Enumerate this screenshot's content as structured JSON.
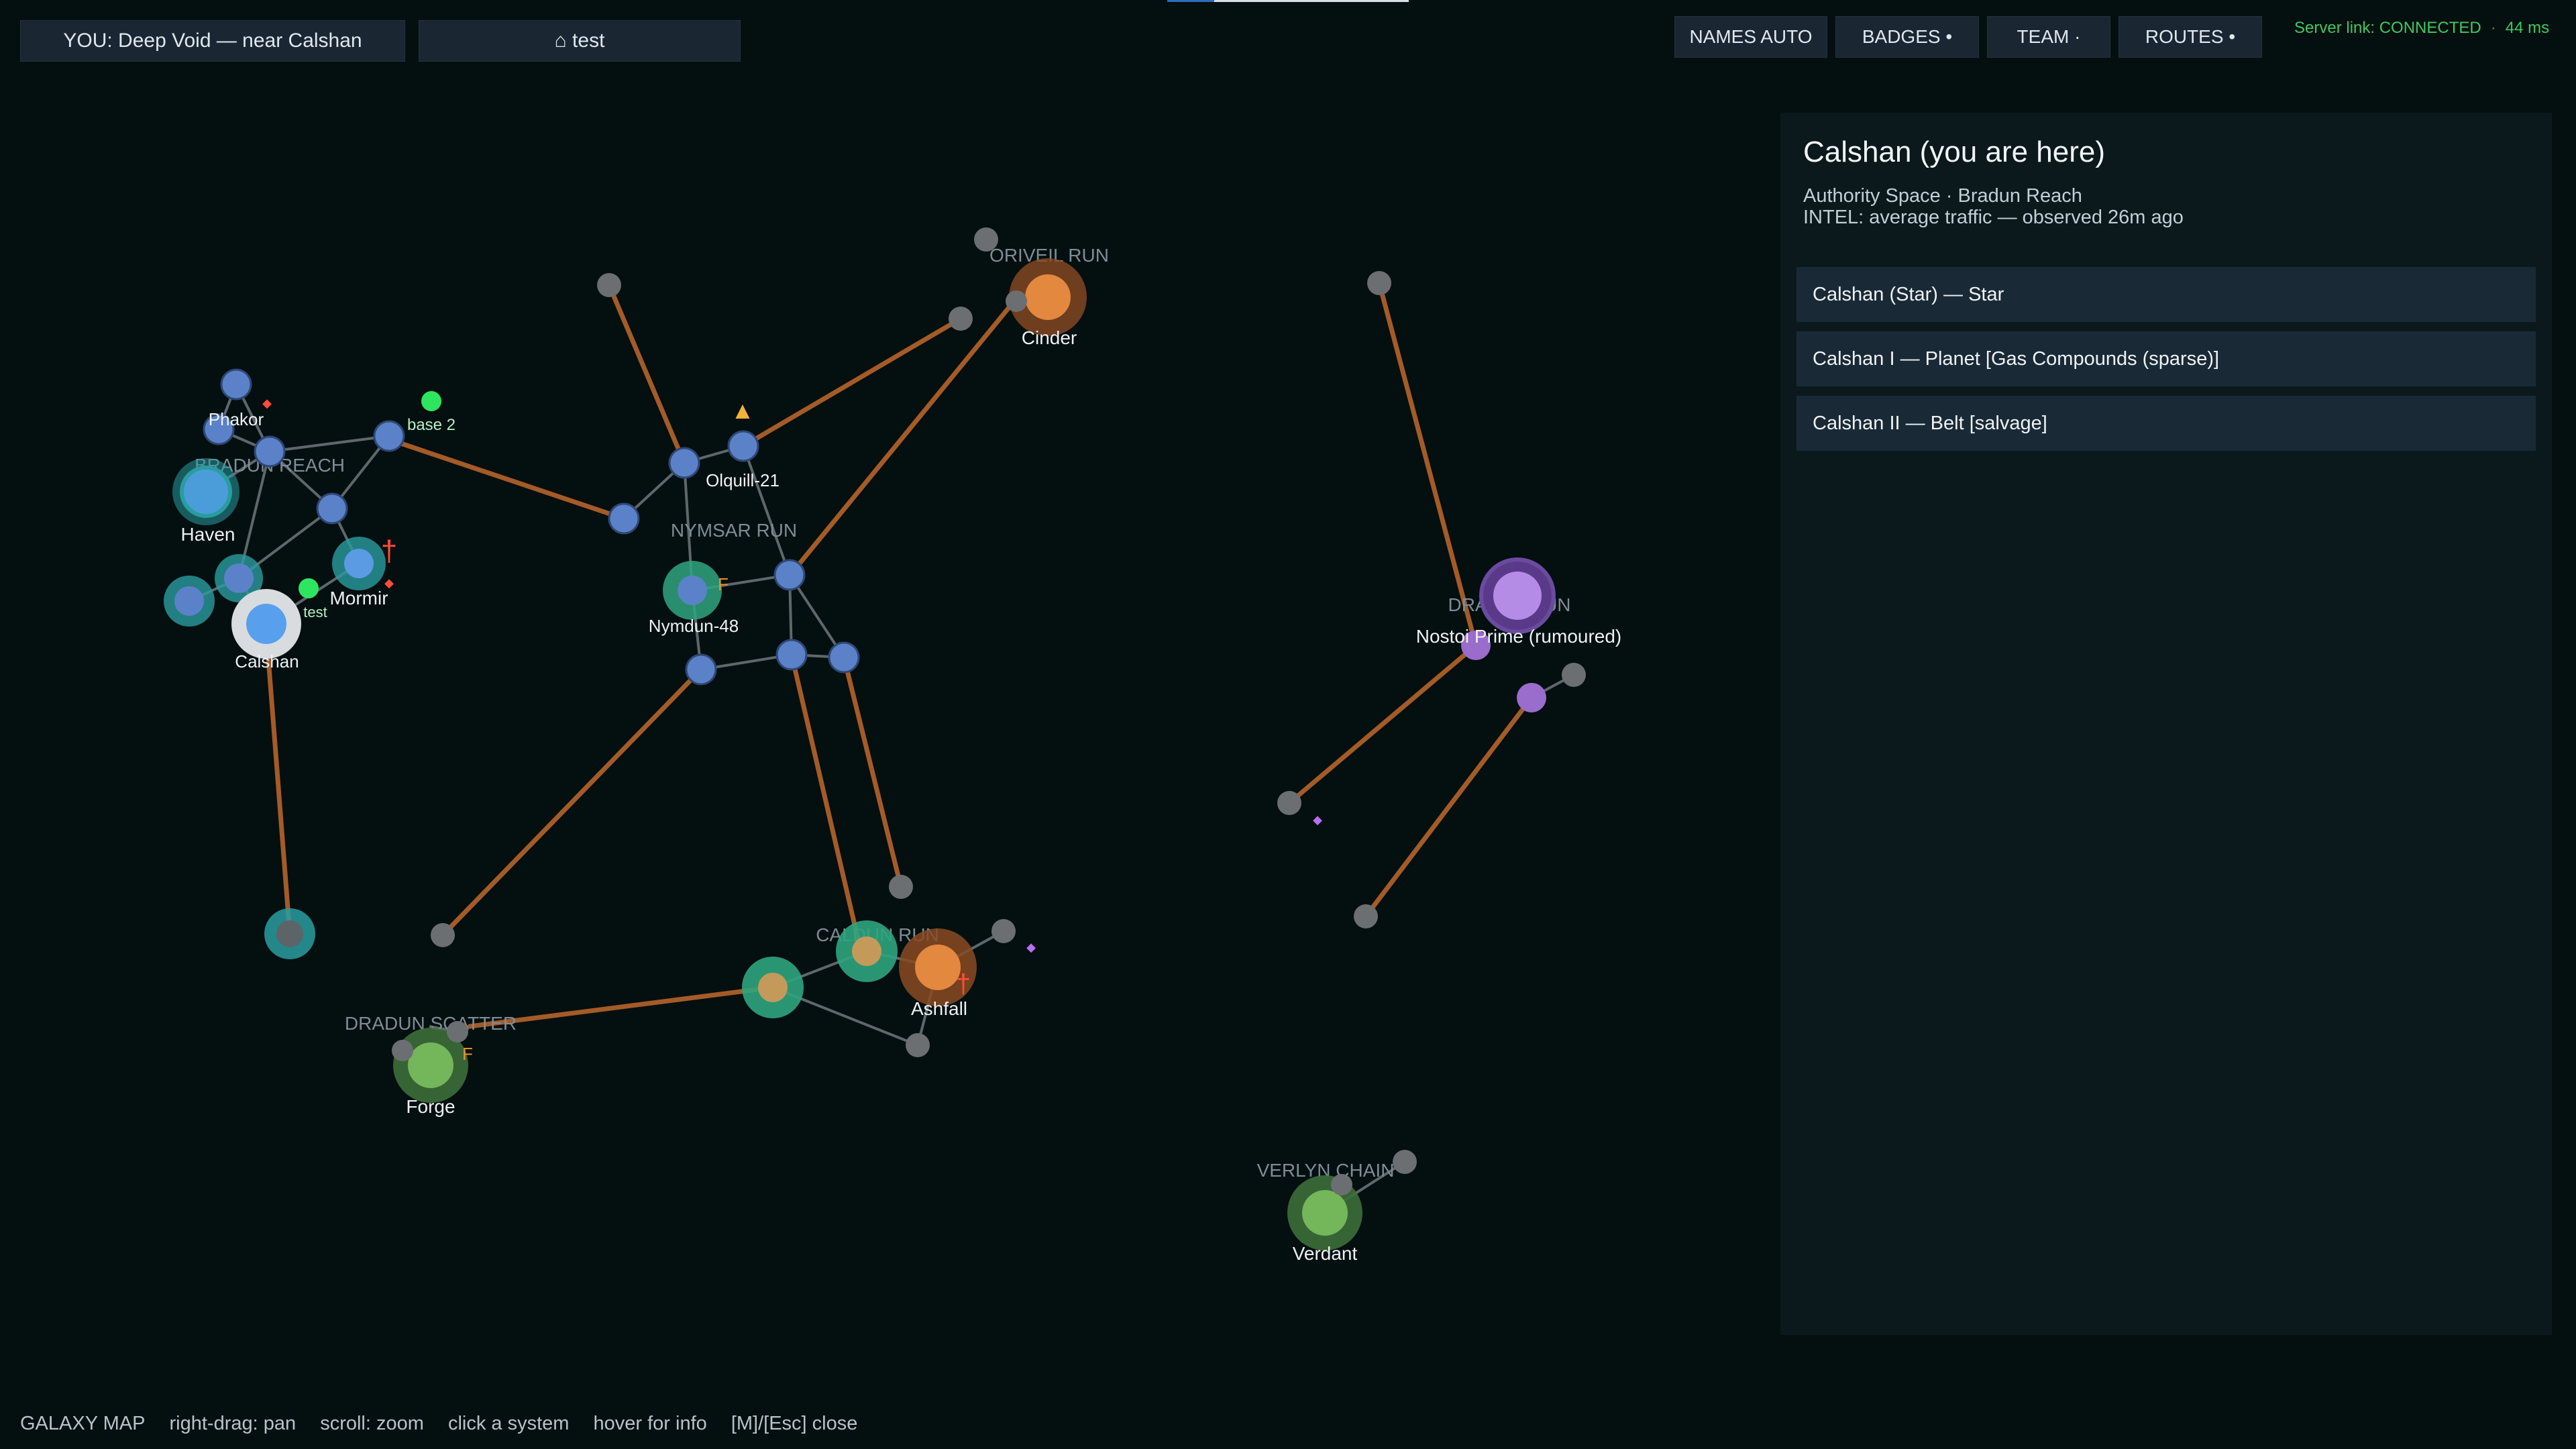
{
  "top_bar": {
    "location_button": "YOU: Deep Void — near Calshan",
    "home_button": "⌂ test",
    "toggles": {
      "names": "NAMES AUTO",
      "badges": "BADGES •",
      "team": "TEAM ·",
      "routes": "ROUTES •"
    },
    "server_status": "Server link: CONNECTED",
    "ping": "44 ms"
  },
  "map": {
    "region_labels": [
      "BRADUN REACH",
      "ORIVEIL RUN",
      "NYMSAR RUN",
      "DRAVEN RUN",
      "CALDUN RUN",
      "DRADUN SCATTER",
      "VERLYN CHAIN"
    ],
    "system_names": {
      "phakor": "Phakor",
      "base2": "base 2",
      "haven": "Haven",
      "mormir": "Mormir",
      "test": "test",
      "calshan": "Calshan",
      "olquill": "Olquill-21",
      "cinder": "Cinder",
      "nymdun": "Nymdun-48",
      "nostoi": "Nostoi Prime (rumoured)",
      "ashfall": "Ashfall",
      "forge": "Forge",
      "verdant": "Verdant"
    },
    "markers": {
      "dagger": "†",
      "flag": "F",
      "warning": "▲",
      "gem": "◆"
    },
    "colors": {
      "background": "#040f10",
      "lane": "#737b7f",
      "route": "#bd6b2c",
      "authority": "#5b82c8",
      "unknown": "#6b6f72",
      "cyan": "#2a9ca0",
      "teal": "#2fa47e",
      "orange": "#e2883f",
      "green": "#6ab04f",
      "purple": "#9a6ccc",
      "base": "#2ee55f",
      "danger": "#ff4c3b",
      "region_label": "#7d8d97"
    }
  },
  "info_panel": {
    "title": "Calshan  (you are here)",
    "subtitle": "Authority Space  ·  Bradun Reach",
    "intel": "INTEL: average traffic — observed 26m ago",
    "bodies": [
      "Calshan (Star)  —  Star",
      "Calshan I  —  Planet  [Gas Compounds (sparse)]",
      "Calshan II  —  Belt  [salvage]"
    ]
  },
  "status_bar": {
    "items": [
      "GALAXY MAP",
      "right-drag: pan",
      "scroll: zoom",
      "click a system",
      "hover for info",
      "[M]/[Esc] close"
    ]
  }
}
